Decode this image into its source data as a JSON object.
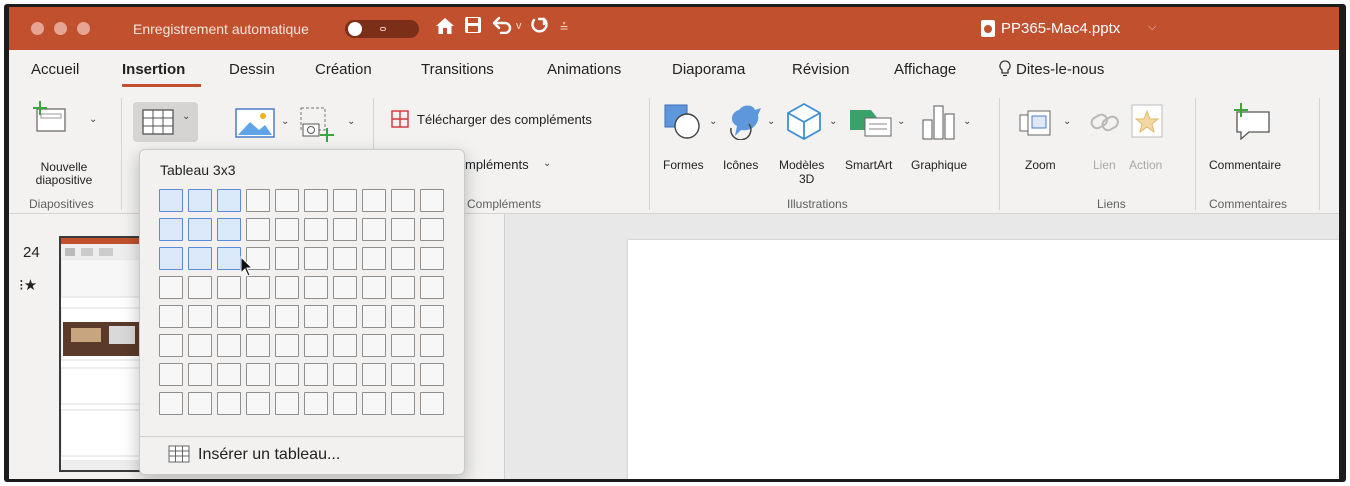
{
  "titlebar": {
    "autosave_label": "Enregistrement automatique",
    "toggle_state": "off",
    "document_title": "PP365-Mac4.pptx",
    "bg_color": "#c1502e"
  },
  "tabs": [
    {
      "label": "Accueil"
    },
    {
      "label": "Insertion",
      "active": true
    },
    {
      "label": "Dessin"
    },
    {
      "label": "Création"
    },
    {
      "label": "Transitions"
    },
    {
      "label": "Animations"
    },
    {
      "label": "Diaporama"
    },
    {
      "label": "Révision"
    },
    {
      "label": "Affichage"
    },
    {
      "label": "Dites-le-nous"
    }
  ],
  "ribbon": {
    "new_slide": {
      "line1": "Nouvelle",
      "line2": "diapositive"
    },
    "diapositives_group": "Diapositives",
    "addins_store": "Télécharger des compléments",
    "addins_my": "mpléments",
    "addins_group": "Compléments",
    "shapes": "Formes",
    "icons": "Icônes",
    "models3d_line1": "Modèles",
    "models3d_line2": "3D",
    "smartart": "SmartArt",
    "chart": "Graphique",
    "illustrations_group": "Illustrations",
    "zoom": "Zoom",
    "link": "Lien",
    "action": "Action",
    "links_group": "Liens",
    "comment": "Commentaire",
    "comments_group": "Commentaires"
  },
  "slides_panel": {
    "slide_number": "24",
    "anim_marker": "⁝★"
  },
  "table_dropdown": {
    "title": "Tableau 3x3",
    "grid_rows": 8,
    "grid_cols": 10,
    "selected_rows": 3,
    "selected_cols": 3,
    "insert_label": "Insérer un tableau..."
  },
  "icons": {
    "home": "home-icon",
    "save": "save-icon",
    "undo": "undo-icon",
    "redo": "redo-icon",
    "customize": "customize-toolbar-icon",
    "lightbulb": "lightbulb-icon"
  }
}
